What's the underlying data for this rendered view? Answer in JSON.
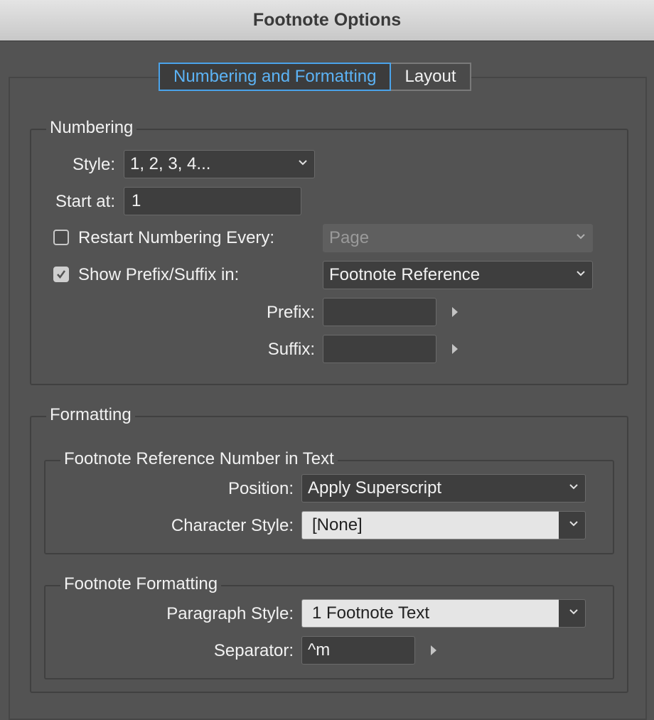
{
  "window": {
    "title": "Footnote Options"
  },
  "tabs": [
    {
      "label": "Numbering and Formatting",
      "active": true
    },
    {
      "label": "Layout",
      "active": false
    }
  ],
  "numbering": {
    "legend": "Numbering",
    "style_label": "Style:",
    "style_value": "1, 2, 3, 4...",
    "start_label": "Start at:",
    "start_value": "1",
    "restart_label": "Restart Numbering Every:",
    "restart_checked": false,
    "restart_value": "Page",
    "prefix_suffix_label": "Show Prefix/Suffix in:",
    "prefix_suffix_checked": true,
    "prefix_suffix_value": "Footnote Reference",
    "prefix_label": "Prefix:",
    "prefix_value": "",
    "suffix_label": "Suffix:",
    "suffix_value": ""
  },
  "formatting": {
    "legend": "Formatting",
    "reference": {
      "legend": "Footnote Reference Number in Text",
      "position_label": "Position:",
      "position_value": "Apply Superscript",
      "char_style_label": "Character Style:",
      "char_style_value": "[None]"
    },
    "footnote": {
      "legend": "Footnote Formatting",
      "para_style_label": "Paragraph Style:",
      "para_style_value": "1 Footnote Text",
      "separator_label": "Separator:",
      "separator_value": "^m"
    }
  },
  "colors": {
    "background": "#535353",
    "accent": "#4aa3ea",
    "titlebar": "#d6d6d6"
  },
  "icons": [
    "chevron-down-icon",
    "triangle-right-icon",
    "checkmark-icon"
  ]
}
